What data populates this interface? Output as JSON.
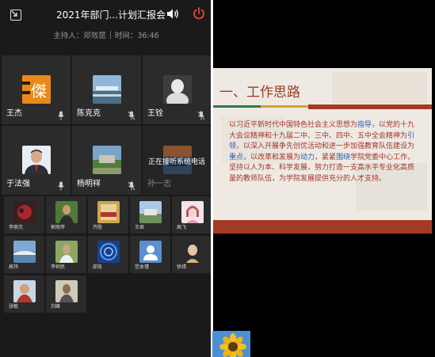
{
  "header": {
    "title": "2021年部门...计划汇报会",
    "host": "主持人：邓效昆",
    "time": "时间：36:46"
  },
  "icons": {
    "minimize": "minimize-window-icon",
    "speaker": "speaker-icon",
    "power": "power-icon"
  },
  "participants_large": [
    {
      "name": "王杰",
      "mic": "on"
    },
    {
      "name": "陈克克",
      "mic": "off"
    },
    {
      "name": "王铨",
      "mic": "off"
    },
    {
      "name": "于法强",
      "mic": "on"
    },
    {
      "name": "杨明祥",
      "mic": "off"
    },
    {
      "name": "孙一志",
      "status": "正在接听系统电话"
    }
  ],
  "participants_small": [
    {
      "name": "李丽杰"
    },
    {
      "name": "郭丽萍"
    },
    {
      "name": "齐胜"
    },
    {
      "name": "王君"
    },
    {
      "name": "高飞"
    },
    {
      "name": "高玮"
    },
    {
      "name": "李树民"
    },
    {
      "name": "邵凯"
    },
    {
      "name": "范本瑾"
    },
    {
      "name": "徐靖"
    },
    {
      "name": "张敏"
    },
    {
      "name": "刘峰"
    }
  ],
  "slide": {
    "title": "一、工作思路",
    "body_parts": [
      {
        "text": "以习近平新时代中国特色社会主义思想为",
        "hl": false
      },
      {
        "text": "指导",
        "hl": true
      },
      {
        "text": "，以党的十九大会议精神和十九届二中、三中、四中、五中全会精神为",
        "hl": false
      },
      {
        "text": "引领",
        "hl": true
      },
      {
        "text": "，以深入开展争先创优活动和进一步加强教育队伍建设为",
        "hl": false
      },
      {
        "text": "重点",
        "hl": true
      },
      {
        "text": "，以改革和发展为",
        "hl": false
      },
      {
        "text": "动力",
        "hl": true
      },
      {
        "text": "，紧紧",
        "hl": false
      },
      {
        "text": "围绕",
        "hl": true
      },
      {
        "text": "学院党委中心工作，坚持以人为本、科学发展，努力打造一支高水平专业化高质量的教师队伍，为学院发展提供充分的人才支持。",
        "hl": false
      }
    ]
  },
  "colors": {
    "background": "#1a1a1a",
    "tile": "#2b2b2b",
    "power_red": "#e8453c",
    "slide_red": "#a33b24",
    "slide_blue": "#2e5aa8"
  }
}
